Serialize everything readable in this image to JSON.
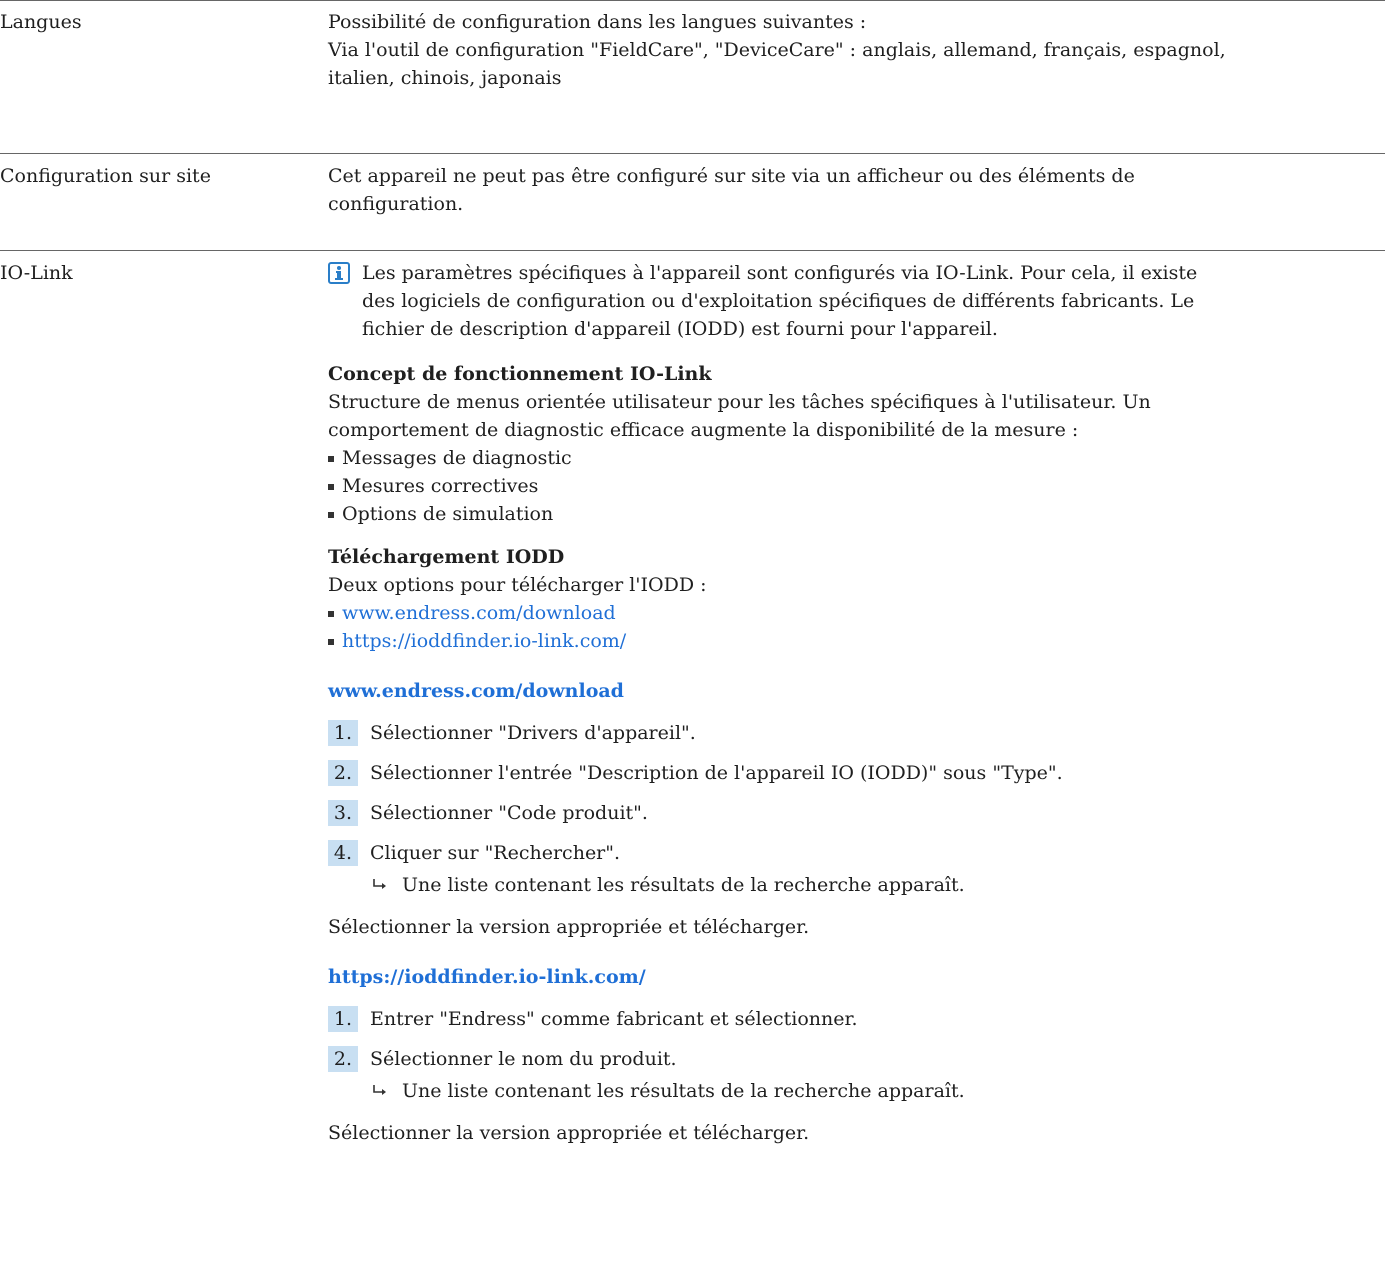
{
  "rows": {
    "langues": {
      "label": "Langues",
      "line1": "Possibilité de configuration dans les langues suivantes :",
      "line2": "Via l'outil de configuration \"FieldCare\", \"DeviceCare\" : anglais, allemand, français, espagnol,",
      "line3": "italien, chinois, japonais"
    },
    "site": {
      "label": "Configuration sur site",
      "line1": "Cet appareil ne peut pas être configuré sur site via un afficheur ou des éléments de",
      "line2": "configuration."
    },
    "iolink": {
      "label": "IO-Link",
      "info_icon": "info-icon",
      "info_line1": "Les paramètres spécifiques à l'appareil sont configurés via IO-Link. Pour cela, il existe",
      "info_line2": "des logiciels de configuration ou d'exploitation spécifiques de différents fabricants. Le",
      "info_line3": "fichier de description d'appareil (IODD) est fourni pour l'appareil.",
      "concept_title": "Concept de fonctionnement IO-Link",
      "concept_line1": "Structure de menus orientée utilisateur pour les tâches spécifiques à l'utilisateur. Un",
      "concept_line2": "comportement de diagnostic efficace augmente la disponibilité de la mesure :",
      "concept_items": [
        "Messages de diagnostic",
        "Mesures correctives",
        "Options de simulation"
      ],
      "download_title": "Téléchargement IODD",
      "download_intro": "Deux options pour télécharger l'IODD :",
      "download_links": [
        "www.endress.com/download",
        "https://ioddfinder.io-link.com/"
      ],
      "section1_title": "www.endress.com/download",
      "section1_steps": [
        "Sélectionner \"Drivers d'appareil\".",
        "Sélectionner l'entrée \"Description de l'appareil IO (IODD)\" sous \"Type\".",
        "Sélectionner \"Code produit\".",
        "Cliquer sur \"Rechercher\"."
      ],
      "section1_step_numbers": [
        "1.",
        "2.",
        "3.",
        "4."
      ],
      "section1_result": "Une liste contenant les résultats de la recherche apparaît.",
      "section1_final": "Sélectionner la version appropriée et télécharger.",
      "section2_title": "https://ioddfinder.io-link.com/",
      "section2_steps": [
        "Entrer \"Endress\" comme fabricant et sélectionner.",
        "Sélectionner le nom du produit."
      ],
      "section2_step_numbers": [
        "1.",
        "2."
      ],
      "section2_result": "Une liste contenant les résultats de la recherche apparaît.",
      "section2_final": "Sélectionner la version appropriée et télécharger."
    }
  },
  "colors": {
    "link": "#1f6fd6",
    "step_bg": "#c8dff2",
    "icon": "#2a7ec8"
  }
}
